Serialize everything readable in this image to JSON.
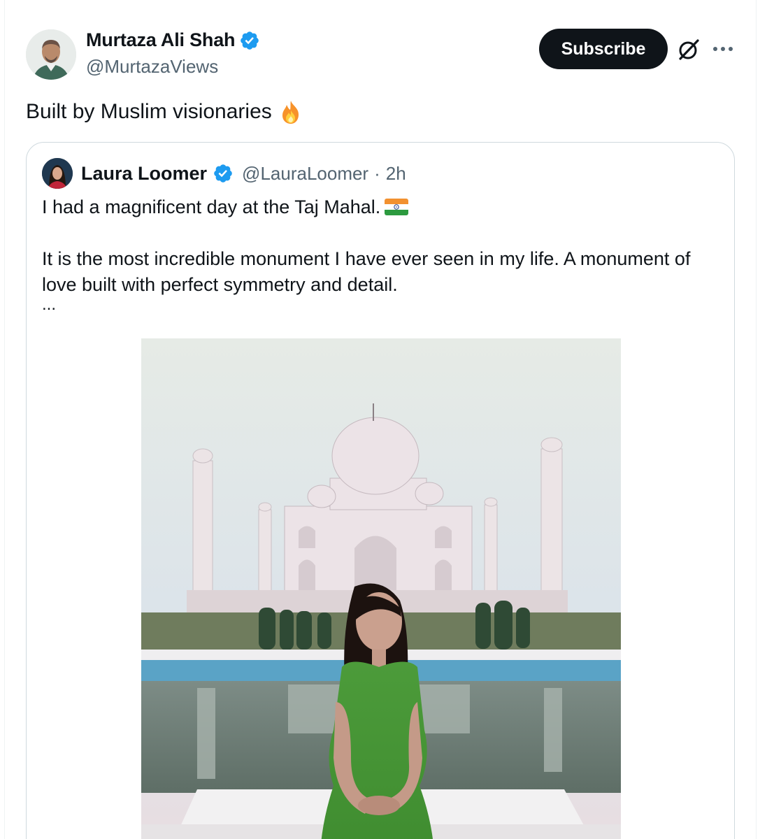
{
  "tweet": {
    "author": {
      "name": "Murtaza Ali Shah",
      "handle": "@MurtazaViews",
      "verified": true
    },
    "subscribe_label": "Subscribe",
    "text": "Built by Muslim visionaries",
    "emoji": "fire-icon"
  },
  "quoted_tweet": {
    "author": {
      "name": "Laura Loomer",
      "handle": "@LauraLoomer",
      "verified": true
    },
    "separator": "·",
    "time": "2h",
    "line1": "I had a magnificent day at the Taj Mahal.",
    "line1_emoji": "india-flag-icon",
    "line2": "It is the most incredible monument I have ever seen in my life. A monument of",
    "line3": "love built with perfect symmetry and detail.",
    "truncation": "...",
    "photo_subject": "woman-in-green-dress-at-taj-mahal"
  },
  "colors": {
    "verified_blue": "#1d9bf0",
    "text_primary": "#0f1419",
    "text_secondary": "#536471",
    "border": "#cfd9de",
    "button_bg": "#0f1419"
  }
}
